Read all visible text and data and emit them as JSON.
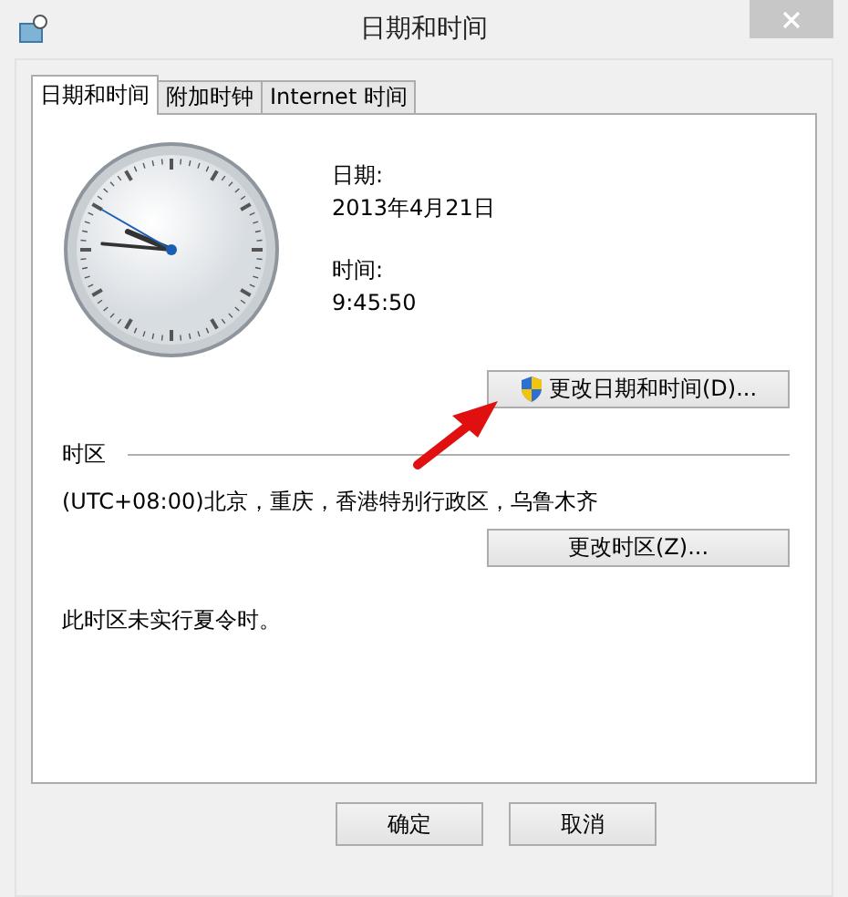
{
  "window": {
    "title": "日期和时间"
  },
  "tabs": [
    {
      "label": "日期和时间",
      "selected": true
    },
    {
      "label": "附加时钟",
      "selected": false
    },
    {
      "label": "Internet 时间",
      "selected": false
    }
  ],
  "date": {
    "label": "日期:",
    "value": "2013年4月21日"
  },
  "time": {
    "label": "时间:",
    "value": "9:45:50"
  },
  "change_datetime_button": "更改日期和时间(D)...",
  "time_zone": {
    "heading": "时区",
    "value": "(UTC+08:00)北京，重庆，香港特别行政区，乌鲁木齐",
    "button": "更改时区(Z)..."
  },
  "dst_note": "此时区未实行夏令时。",
  "buttons": [
    "确定",
    "取消"
  ]
}
